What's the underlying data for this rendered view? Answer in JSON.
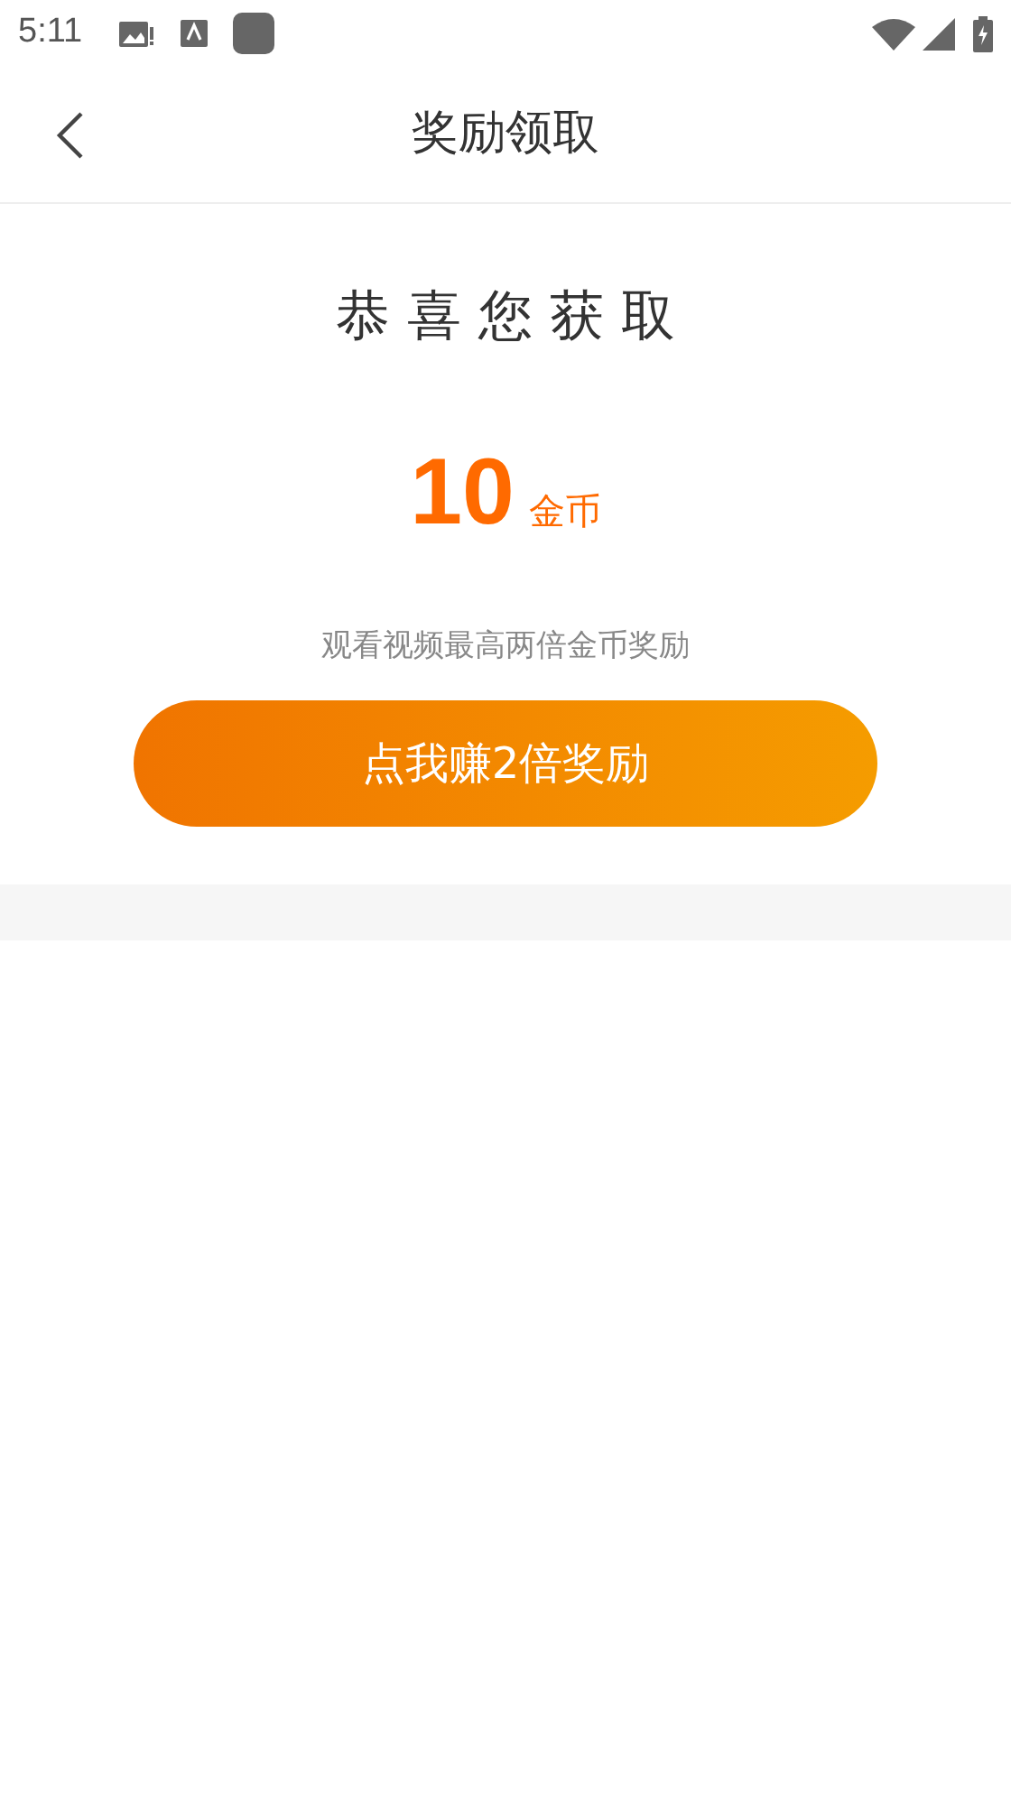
{
  "status_bar": {
    "time": "5:11"
  },
  "header": {
    "title": "奖励领取"
  },
  "reward": {
    "heading": "恭 喜 您 获 取",
    "amount": "10",
    "unit": "金币",
    "hint": "观看视频最高两倍金币奖励",
    "button": "点我赚2倍奖励"
  }
}
